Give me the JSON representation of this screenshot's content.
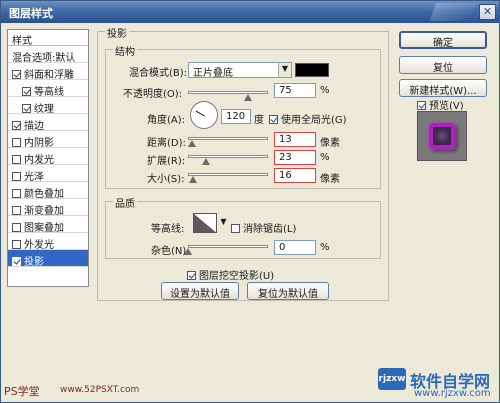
{
  "window": {
    "title": "图层样式"
  },
  "sidebar": {
    "header": "样式",
    "items": [
      {
        "label": "混合选项:默认",
        "checkbox": false,
        "checked": false,
        "indent": false
      },
      {
        "label": "斜面和浮雕",
        "checkbox": true,
        "checked": true,
        "indent": false
      },
      {
        "label": "等高线",
        "checkbox": true,
        "checked": true,
        "indent": true
      },
      {
        "label": "纹理",
        "checkbox": true,
        "checked": true,
        "indent": true
      },
      {
        "label": "描边",
        "checkbox": true,
        "checked": true,
        "indent": false
      },
      {
        "label": "内阴影",
        "checkbox": true,
        "checked": false,
        "indent": false
      },
      {
        "label": "内发光",
        "checkbox": true,
        "checked": false,
        "indent": false
      },
      {
        "label": "光泽",
        "checkbox": true,
        "checked": false,
        "indent": false
      },
      {
        "label": "颜色叠加",
        "checkbox": true,
        "checked": false,
        "indent": false
      },
      {
        "label": "渐变叠加",
        "checkbox": true,
        "checked": false,
        "indent": false
      },
      {
        "label": "图案叠加",
        "checkbox": true,
        "checked": false,
        "indent": false
      },
      {
        "label": "外发光",
        "checkbox": true,
        "checked": false,
        "indent": false
      },
      {
        "label": "投影",
        "checkbox": true,
        "checked": true,
        "indent": false,
        "selected": true
      }
    ]
  },
  "panel": {
    "title": "投影",
    "structure": {
      "title": "结构",
      "blend_mode_label": "混合模式(B):",
      "blend_mode_value": "正片叠底",
      "blend_color": "#000000",
      "opacity_label": "不透明度(O):",
      "opacity_value": "75",
      "opacity_unit": "%",
      "opacity_level": 0.75,
      "angle_label": "角度(A):",
      "angle_value": "120",
      "angle_unit": "度",
      "global_light_label": "使用全局光(G)",
      "global_light_checked": true,
      "distance_label": "距离(D):",
      "distance_value": "13",
      "distance_unit": "像素",
      "distance_level": 0.05,
      "spread_label": "扩展(R):",
      "spread_value": "23",
      "spread_unit": "%",
      "spread_level": 0.23,
      "size_label": "大小(S):",
      "size_value": "16",
      "size_unit": "像素",
      "size_level": 0.06
    },
    "quality": {
      "title": "品质",
      "contour_label": "等高线:",
      "antialias_label": "消除锯齿(L)",
      "antialias_checked": false,
      "noise_label": "杂色(N):",
      "noise_value": "0",
      "noise_unit": "%",
      "noise_level": 0.0
    },
    "knockout_label": "图层挖空投影(U)",
    "knockout_checked": true,
    "set_default_label": "设置为默认值",
    "reset_default_label": "复位为默认值"
  },
  "buttons": {
    "ok": "确定",
    "reset": "复位",
    "new_style": "新建样式(W)...",
    "preview_label": "预览(V)",
    "preview_checked": true
  },
  "watermarks": {
    "left": "PS学堂",
    "mid": "www.52PSXT.com",
    "right_logo": "rjzxw",
    "right_name": "软件自学网",
    "right_url": "www.rjzxw.com"
  },
  "colors": {
    "title_bar": "#3f6aa6",
    "selected_item": "#3168c6",
    "highlight_border": "#e04040",
    "preview_stroke": "#b020c0"
  }
}
